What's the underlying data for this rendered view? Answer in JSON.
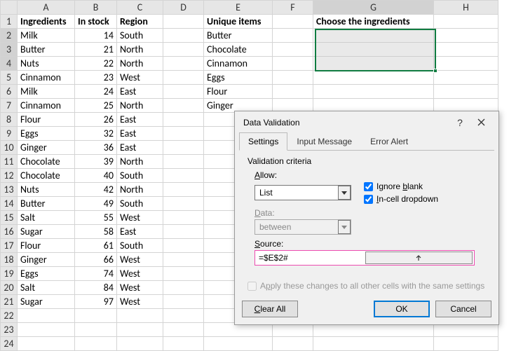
{
  "sheet": {
    "columns": [
      "A",
      "B",
      "C",
      "D",
      "E",
      "F",
      "G",
      "H"
    ],
    "headers": {
      "A": "Ingredients",
      "B": "In stock",
      "C": "Region",
      "E": "Unique items",
      "G": "Choose the ingredients"
    },
    "rows": [
      {
        "n": 1
      },
      {
        "n": 2,
        "A": "Milk",
        "B": "14",
        "C": "South",
        "E": "Butter"
      },
      {
        "n": 3,
        "A": "Butter",
        "B": "21",
        "C": "North",
        "E": "Chocolate"
      },
      {
        "n": 4,
        "A": "Nuts",
        "B": "22",
        "C": "North",
        "E": "Cinnamon"
      },
      {
        "n": 5,
        "A": "Cinnamon",
        "B": "23",
        "C": "West",
        "E": "Eggs"
      },
      {
        "n": 6,
        "A": "Milk",
        "B": "24",
        "C": "East",
        "E": "Flour"
      },
      {
        "n": 7,
        "A": "Cinnamon",
        "B": "25",
        "C": "North",
        "E": "Ginger"
      },
      {
        "n": 8,
        "A": "Flour",
        "B": "26",
        "C": "East"
      },
      {
        "n": 9,
        "A": "Eggs",
        "B": "32",
        "C": "East"
      },
      {
        "n": 10,
        "A": "Ginger",
        "B": "36",
        "C": "East"
      },
      {
        "n": 11,
        "A": "Chocolate",
        "B": "39",
        "C": "North"
      },
      {
        "n": 12,
        "A": "Chocolate",
        "B": "40",
        "C": "South"
      },
      {
        "n": 13,
        "A": "Nuts",
        "B": "42",
        "C": "North"
      },
      {
        "n": 14,
        "A": "Butter",
        "B": "49",
        "C": "South"
      },
      {
        "n": 15,
        "A": "Salt",
        "B": "55",
        "C": "West"
      },
      {
        "n": 16,
        "A": "Sugar",
        "B": "58",
        "C": "East"
      },
      {
        "n": 17,
        "A": "Flour",
        "B": "61",
        "C": "South"
      },
      {
        "n": 18,
        "A": "Ginger",
        "B": "66",
        "C": "West"
      },
      {
        "n": 19,
        "A": "Eggs",
        "B": "74",
        "C": "West"
      },
      {
        "n": 20,
        "A": "Salt",
        "B": "84",
        "C": "West"
      },
      {
        "n": 21,
        "A": "Sugar",
        "B": "97",
        "C": "West"
      },
      {
        "n": 22
      },
      {
        "n": 23
      },
      {
        "n": 24
      }
    ]
  },
  "dialog": {
    "title": "Data Validation",
    "tabs": {
      "settings": "Settings",
      "input_message": "Input Message",
      "error_alert": "Error Alert"
    },
    "criteria_label": "Validation criteria",
    "allow_label": "Allow:",
    "allow_value": "List",
    "data_label": "Data:",
    "data_value": "between",
    "source_label": "Source:",
    "source_value": "=$E$2#",
    "ignore_blank": "Ignore blank",
    "incell_dropdown": "In-cell dropdown",
    "apply_all": "Apply these changes to all other cells with the same settings",
    "clear_all": "Clear All",
    "ok": "OK",
    "cancel": "Cancel",
    "help": "?"
  }
}
